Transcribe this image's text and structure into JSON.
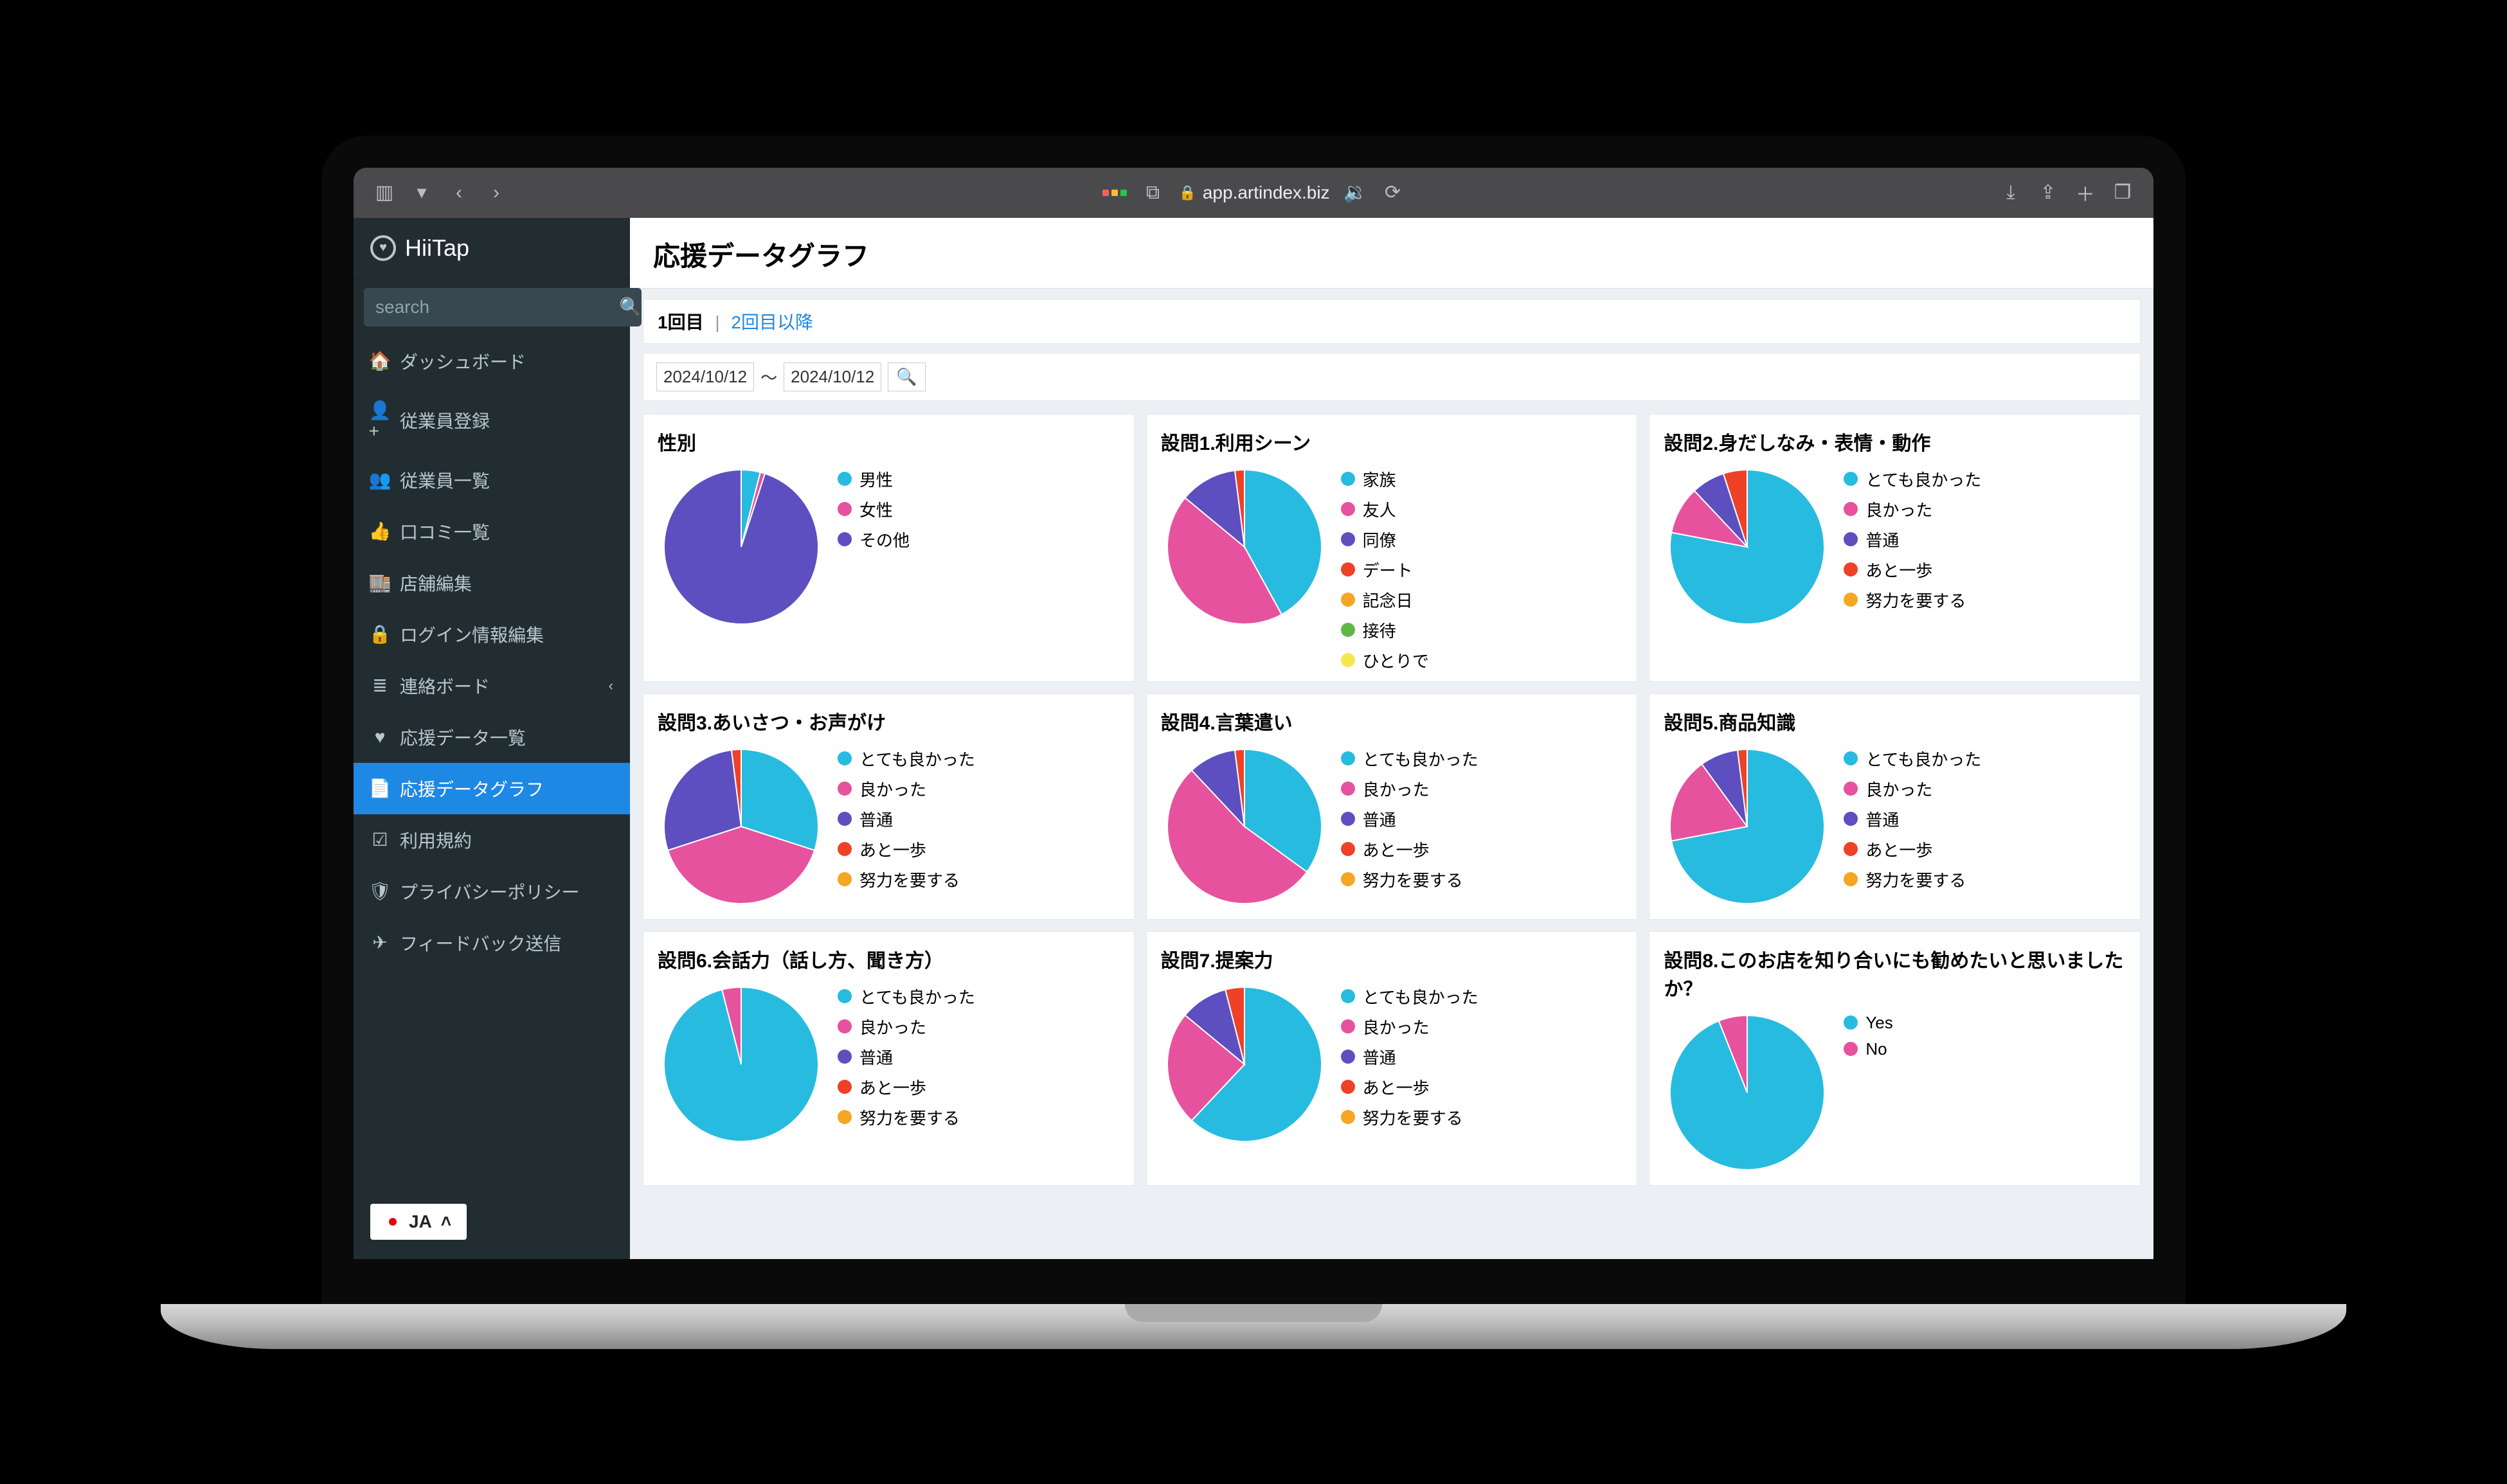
{
  "browser": {
    "url_host": "app.artindex.biz"
  },
  "brand": "HiiTap",
  "search": {
    "placeholder": "search"
  },
  "sidebar": {
    "items": [
      {
        "icon": "dash",
        "label": "ダッシュボード"
      },
      {
        "icon": "user-plus",
        "label": "従業員登録"
      },
      {
        "icon": "users",
        "label": "従業員一覧"
      },
      {
        "icon": "thumbs-up",
        "label": "口コミ一覧"
      },
      {
        "icon": "store",
        "label": "店舗編集"
      },
      {
        "icon": "lock",
        "label": "ログイン情報編集"
      },
      {
        "icon": "list",
        "label": "連絡ボード",
        "arrow": true
      },
      {
        "icon": "heart",
        "label": "応援データ一覧"
      },
      {
        "icon": "file",
        "label": "応援データグラフ",
        "active": true
      },
      {
        "icon": "check",
        "label": "利用規約"
      },
      {
        "icon": "shield",
        "label": "プライバシーポリシー"
      },
      {
        "icon": "send",
        "label": "フィードバック送信"
      }
    ]
  },
  "lang": {
    "code": "JA"
  },
  "header": {
    "title": "応援データグラフ"
  },
  "tabs": {
    "current": "1回目",
    "other": "2回目以降"
  },
  "dates": {
    "from": "2024/10/12",
    "to": "2024/10/12",
    "sep": "〜"
  },
  "colors": {
    "cyan": "#27bbe0",
    "pink": "#e6529e",
    "purple": "#5d4fbf",
    "red": "#ef4128",
    "orange": "#f5a623",
    "green": "#5fb848",
    "yellow": "#f3e84d"
  },
  "chart_data": [
    {
      "type": "pie",
      "title": "性別",
      "series": [
        {
          "name": "男性",
          "value": 4,
          "color": "cyan"
        },
        {
          "name": "女性",
          "value": 1,
          "color": "pink"
        },
        {
          "name": "その他",
          "value": 95,
          "color": "purple"
        }
      ]
    },
    {
      "type": "pie",
      "title": "設問1.利用シーン",
      "series": [
        {
          "name": "家族",
          "value": 42,
          "color": "cyan"
        },
        {
          "name": "友人",
          "value": 44,
          "color": "pink"
        },
        {
          "name": "同僚",
          "value": 12,
          "color": "purple"
        },
        {
          "name": "デート",
          "value": 2,
          "color": "red"
        },
        {
          "name": "記念日",
          "value": 0,
          "color": "orange"
        },
        {
          "name": "接待",
          "value": 0,
          "color": "green"
        },
        {
          "name": "ひとりで",
          "value": 0,
          "color": "yellow"
        }
      ]
    },
    {
      "type": "pie",
      "title": "設問2.身だしなみ・表情・動作",
      "series": [
        {
          "name": "とても良かった",
          "value": 78,
          "color": "cyan"
        },
        {
          "name": "良かった",
          "value": 10,
          "color": "pink"
        },
        {
          "name": "普通",
          "value": 7,
          "color": "purple"
        },
        {
          "name": "あと一歩",
          "value": 5,
          "color": "red"
        },
        {
          "name": "努力を要する",
          "value": 0,
          "color": "orange"
        }
      ]
    },
    {
      "type": "pie",
      "title": "設問3.あいさつ・お声がけ",
      "series": [
        {
          "name": "とても良かった",
          "value": 30,
          "color": "cyan"
        },
        {
          "name": "良かった",
          "value": 40,
          "color": "pink"
        },
        {
          "name": "普通",
          "value": 28,
          "color": "purple"
        },
        {
          "name": "あと一歩",
          "value": 2,
          "color": "red"
        },
        {
          "name": "努力を要する",
          "value": 0,
          "color": "orange"
        }
      ]
    },
    {
      "type": "pie",
      "title": "設問4.言葉遣い",
      "series": [
        {
          "name": "とても良かった",
          "value": 35,
          "color": "cyan"
        },
        {
          "name": "良かった",
          "value": 53,
          "color": "pink"
        },
        {
          "name": "普通",
          "value": 10,
          "color": "purple"
        },
        {
          "name": "あと一歩",
          "value": 2,
          "color": "red"
        },
        {
          "name": "努力を要する",
          "value": 0,
          "color": "orange"
        }
      ]
    },
    {
      "type": "pie",
      "title": "設問5.商品知識",
      "series": [
        {
          "name": "とても良かった",
          "value": 72,
          "color": "cyan"
        },
        {
          "name": "良かった",
          "value": 18,
          "color": "pink"
        },
        {
          "name": "普通",
          "value": 8,
          "color": "purple"
        },
        {
          "name": "あと一歩",
          "value": 2,
          "color": "red"
        },
        {
          "name": "努力を要する",
          "value": 0,
          "color": "orange"
        }
      ]
    },
    {
      "type": "pie",
      "title": "設問6.会話力（話し方、聞き方）",
      "series": [
        {
          "name": "とても良かった",
          "value": 96,
          "color": "cyan"
        },
        {
          "name": "良かった",
          "value": 4,
          "color": "pink"
        },
        {
          "name": "普通",
          "value": 0,
          "color": "purple"
        },
        {
          "name": "あと一歩",
          "value": 0,
          "color": "red"
        },
        {
          "name": "努力を要する",
          "value": 0,
          "color": "orange"
        }
      ]
    },
    {
      "type": "pie",
      "title": "設問7.提案力",
      "series": [
        {
          "name": "とても良かった",
          "value": 62,
          "color": "cyan"
        },
        {
          "name": "良かった",
          "value": 24,
          "color": "pink"
        },
        {
          "name": "普通",
          "value": 10,
          "color": "purple"
        },
        {
          "name": "あと一歩",
          "value": 4,
          "color": "red"
        },
        {
          "name": "努力を要する",
          "value": 0,
          "color": "orange"
        }
      ]
    },
    {
      "type": "pie",
      "title": "設問8.このお店を知り合いにも勧めたいと思いましたか？",
      "series": [
        {
          "name": "Yes",
          "value": 94,
          "color": "cyan"
        },
        {
          "name": "No",
          "value": 6,
          "color": "pink"
        }
      ]
    }
  ]
}
